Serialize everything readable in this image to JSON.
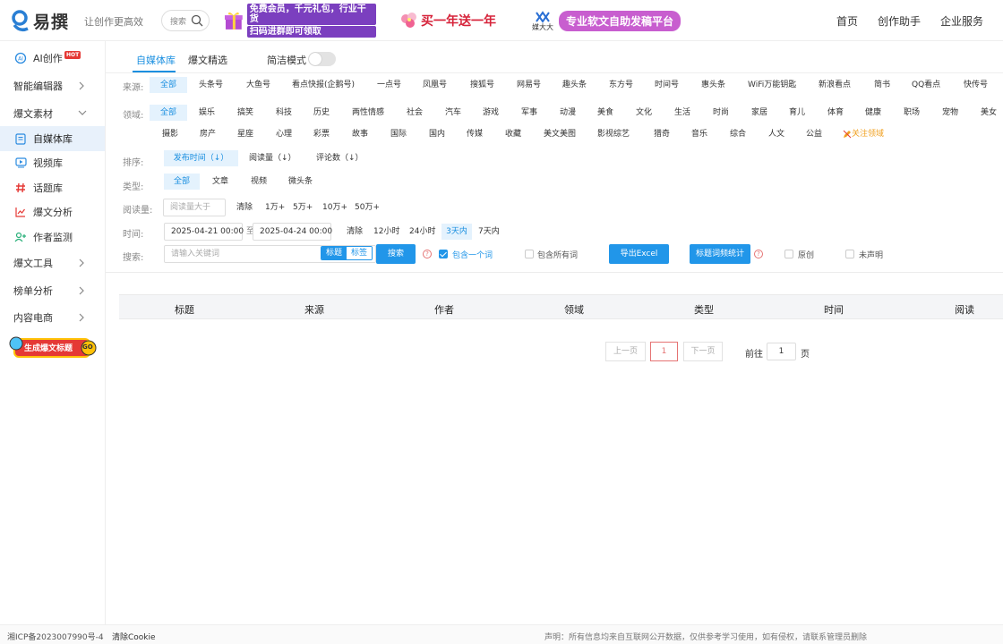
{
  "header": {
    "logo_text": "易撰",
    "slogan": "让创作更高效",
    "search_label": "搜索",
    "banner1_line1": "免费会员，千元礼包，行业干货",
    "banner1_line2": "扫码进群即可领取",
    "banner2_text": "买一年送一年",
    "banner3_brand": "媒大大",
    "banner3_text": "专业软文自助发稿平台",
    "nav": [
      "首页",
      "创作助手",
      "企业服务"
    ]
  },
  "sidebar": {
    "ai": "AI创作",
    "hot": "HOT",
    "editor": "智能编辑器",
    "material": "爆文素材",
    "sub": [
      "自媒体库",
      "视频库",
      "话题库",
      "爆文分析",
      "作者监测"
    ],
    "tools": "爆文工具",
    "ranking": "榜单分析",
    "commerce": "内容电商",
    "gen_badge": "生成爆文标题",
    "go": "GO"
  },
  "tabs": {
    "t1": "自媒体库",
    "t2": "爆文精选",
    "simple_mode": "简洁模式"
  },
  "filters": {
    "source_label": "来源:",
    "sources": [
      "全部",
      "头条号",
      "大鱼号",
      "看点快报(企鹅号)",
      "一点号",
      "凤凰号",
      "搜狐号",
      "网易号",
      "趣头条",
      "东方号",
      "时间号",
      "惠头条",
      "WiFi万能钥匙",
      "新浪看点",
      "简书",
      "QQ看点",
      "快传号"
    ],
    "field_label": "领域:",
    "fields_row1": [
      "全部",
      "娱乐",
      "搞笑",
      "科技",
      "历史",
      "两性情感",
      "社会",
      "汽车",
      "游戏",
      "军事",
      "动漫",
      "美食",
      "文化",
      "生活",
      "时尚",
      "家居",
      "育儿",
      "体育",
      "健康",
      "职场",
      "宠物",
      "美女"
    ],
    "fields_row2": [
      "摄影",
      "房产",
      "星座",
      "心理",
      "彩票",
      "故事",
      "国际",
      "国内",
      "传媒",
      "收藏",
      "美文美图",
      "影视综艺",
      "猎奇",
      "音乐",
      "综合",
      "人文",
      "公益"
    ],
    "follow_field": "关注领域",
    "sort_label": "排序:",
    "sorts": [
      "发布时间（↓）",
      "阅读量（↓）",
      "评论数（↓）"
    ],
    "type_label": "类型:",
    "types": [
      "全部",
      "文章",
      "视频",
      "微头条"
    ],
    "read_label": "阅读量:",
    "read_placeholder": "阅读量大于",
    "read_opts": [
      "清除",
      "1万+",
      "5万+",
      "10万+",
      "50万+"
    ],
    "time_label": "时间:",
    "time_start": "2025-04-21 00:00",
    "time_to": "至",
    "time_end": "2025-04-24 00:00",
    "time_opts": [
      "清除",
      "12小时",
      "24小时",
      "3天内",
      "7天内"
    ],
    "search_label": "搜索:",
    "search_placeholder": "请输入关键词",
    "seg_title": "标题",
    "seg_tag": "标签",
    "search_btn": "搜索",
    "q": "?",
    "contains_one": "包含一个词",
    "contains_all": "包含所有词",
    "export_btn": "导出Excel",
    "freq_btn": "标题词频统计",
    "original": "原创",
    "undeclared": "未声明"
  },
  "table": {
    "columns": [
      "标题",
      "来源",
      "作者",
      "领域",
      "类型",
      "时间",
      "阅读"
    ]
  },
  "pagination": {
    "prev": "上一页",
    "current": "1",
    "next": "下一页",
    "goto": "前往",
    "goto_value": "1",
    "page_unit": "页"
  },
  "footer": {
    "icp": "湘ICP备2023007990号-4",
    "clear_cookie": "清除Cookie",
    "statement": "声明：所有信息均来自互联网公开数据，仅供参考学习使用，如有侵权，请联系管理员删除"
  },
  "colors": {
    "accent": "#2196e9",
    "selected_bg": "#e4f2fd",
    "follow": "#f0a020"
  }
}
